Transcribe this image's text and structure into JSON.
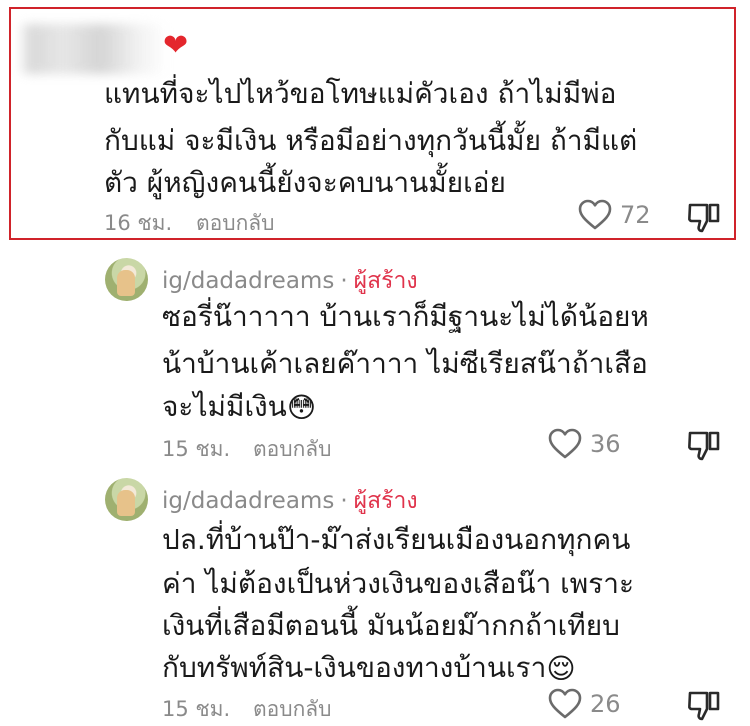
{
  "comment": {
    "reaction_icon": "red-heart-icon",
    "lines": [
      "แทนที่จะไปไหว้ขอโทษแม่คัวเอง ถ้าไม่มีพ่อ",
      "กับแม่ จะมีเงิน หรือมีอย่างทุกวันนี้มั้ย ถ้ามีแต่",
      "ตัว ผู้หญิงคนนี้ยังจะคบนานมั้ยเอ่ย"
    ],
    "time": "16 ชม.",
    "reply_label": "ตอบกลับ",
    "likes": "72",
    "highlight_color": "#d0232a"
  },
  "replies": [
    {
      "username": "ig/dadadreams",
      "separator": "·",
      "creator_label": "ผู้สร้าง",
      "lines": [
        "ซอรี่น๊าาาาา บ้านเราก็มีฐานะไม่ได้น้อยห",
        "น้าบ้านเค้าเลยค๊าาาา ไม่ซีเรียสน๊าถ้าเสือ",
        "จะไม่มีเงิน"
      ],
      "emoji": "😳",
      "time": "15 ชม.",
      "reply_label": "ตอบกลับ",
      "likes": "36"
    },
    {
      "username": "ig/dadadreams",
      "separator": "·",
      "creator_label": "ผู้สร้าง",
      "lines": [
        "ปล.ที่บ้านป๊า-ม๊าส่งเรียนเมืองนอกทุกคน",
        "ค่า ไม่ต้องเป็นห่วงเงินของเสือน๊า เพราะ",
        "เงินที่เสือมีตอนนี้ มันน้อยม๊ากกถ้าเทียบ",
        "กับทรัพท์สิน-เงินของทางบ้านเรา"
      ],
      "emoji": "😌",
      "time": "15 ชม.",
      "reply_label": "ตอบกลับ",
      "likes": "26"
    }
  ],
  "colors": {
    "creator": "#e0334b",
    "meta": "#8a8a8a",
    "text": "#1a1a1a"
  }
}
